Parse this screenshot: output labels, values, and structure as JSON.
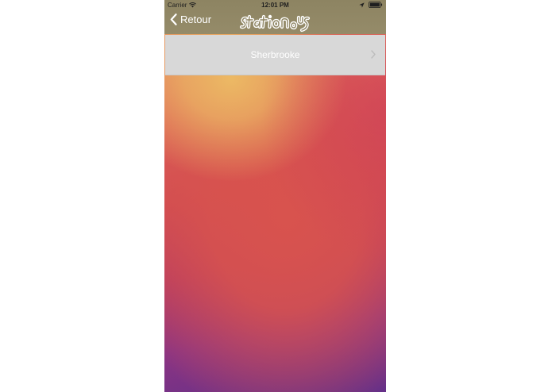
{
  "status_bar": {
    "carrier": "Carrier",
    "time": "12:01 PM"
  },
  "navbar": {
    "back_label": "Retour",
    "logo_text": "stationous"
  },
  "list": {
    "items": [
      {
        "label": "Sherbrooke"
      }
    ]
  },
  "colors": {
    "navbar": "#8d8462",
    "row_background": "#d8d8d8",
    "gradient_top": "#ecb964",
    "gradient_mid": "#d8534e",
    "gradient_bottom": "#653088"
  },
  "icons": [
    "wifi-icon",
    "location-icon",
    "battery-icon",
    "chevron-left-icon",
    "chevron-right-icon"
  ]
}
